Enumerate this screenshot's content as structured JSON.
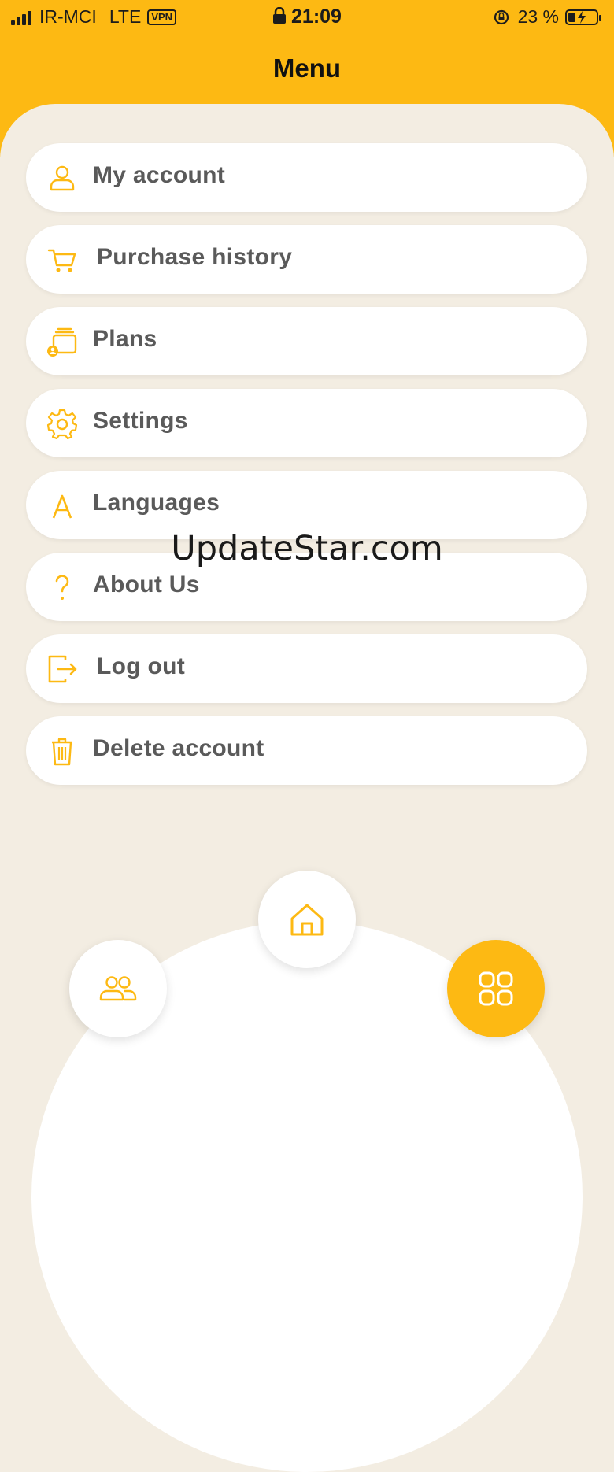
{
  "status_bar": {
    "carrier": "IR-MCI",
    "network": "LTE",
    "vpn": "VPN",
    "time": "21:09",
    "battery_percent": "23 %",
    "battery_level": 0.23
  },
  "header": {
    "title": "Menu"
  },
  "menu": {
    "items": [
      {
        "label": "My account",
        "icon": "user-icon"
      },
      {
        "label": "Purchase history",
        "icon": "cart-icon"
      },
      {
        "label": "Plans",
        "icon": "plans-icon"
      },
      {
        "label": "Settings",
        "icon": "gear-icon"
      },
      {
        "label": "Languages",
        "icon": "language-icon"
      },
      {
        "label": "About Us",
        "icon": "question-icon"
      },
      {
        "label": "Log out",
        "icon": "logout-icon"
      },
      {
        "label": "Delete account",
        "icon": "trash-icon"
      }
    ]
  },
  "watermark": "UpdateStar.com",
  "bottom_nav": {
    "items": [
      {
        "icon": "users-icon",
        "active": false
      },
      {
        "icon": "home-icon",
        "active": false
      },
      {
        "icon": "grid-icon",
        "active": true
      }
    ]
  },
  "colors": {
    "accent": "#FDB913",
    "background": "#F3EDE2",
    "card": "#FFFFFF",
    "label": "#5a5a5a"
  }
}
